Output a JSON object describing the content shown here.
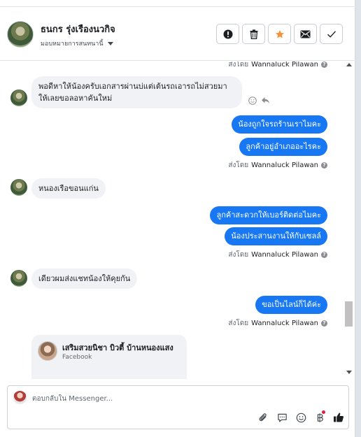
{
  "header": {
    "contact_name": "ธนกร รุ่งเรืองนวกิจ",
    "assign_label": "มอบหมายการสนทนานี้",
    "actions": [
      {
        "name": "report-button",
        "icon": "alert-icon"
      },
      {
        "name": "delete-button",
        "icon": "trash-icon"
      },
      {
        "name": "star-button",
        "icon": "star-icon"
      },
      {
        "name": "mail-button",
        "icon": "mail-icon"
      },
      {
        "name": "done-button",
        "icon": "check-icon"
      }
    ]
  },
  "sent_by_label": "ส่งโดย",
  "sender_name": "Wannaluck Pilawan",
  "help_glyph": "?",
  "messages": [
    {
      "type": "incoming",
      "text": "พอดีหาให้น้องครับเอกสารผ่านบ่แต่เต้นรถเอารถไม่สวยมา ให้เลยขอลอหาคันใหม่"
    },
    {
      "type": "outgoing",
      "text": "น้องถูกใจรถร้านเราไมคะ"
    },
    {
      "type": "outgoing",
      "text": "ลูกค้าอยู่อำเภออะไรคะ"
    },
    {
      "type": "incoming",
      "text": "หนองเรือขอนแก่น"
    },
    {
      "type": "outgoing",
      "text": "ลูกค้าสะดวกให้เบอร์ติดต่อไมคะ"
    },
    {
      "type": "outgoing",
      "text": "น้องประสานงานให้กับเซลล์"
    },
    {
      "type": "incoming",
      "text": "เดียวผมส่งแชทน้องให้คุยกัน"
    },
    {
      "type": "outgoing",
      "text": "ขอเป็นไลน์ก็ได้ค่ะ"
    }
  ],
  "card": {
    "title": "เสริมสวยนิชา บิวตี้ บ้านหนองแสง",
    "subtitle": "Facebook"
  },
  "composer": {
    "placeholder": "ตอบกลับใน Messenger..."
  },
  "colors": {
    "accent": "#1877f2",
    "incoming_bubble": "#f0f2f5",
    "star": "#f7923b"
  }
}
